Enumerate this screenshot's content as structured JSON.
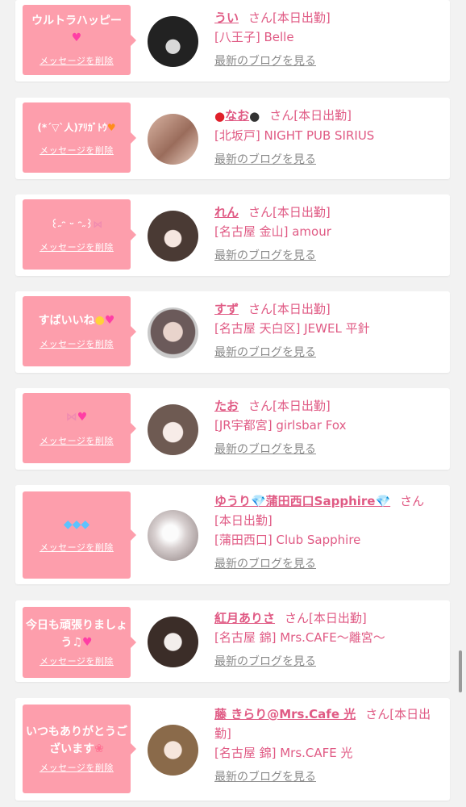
{
  "delete_label": "メッセージを削除",
  "blog_label": "最新のブログを見る",
  "san_label": "さん",
  "colors": {
    "accent_pink": "#fd9eac",
    "name_pink": "#e05a84",
    "link_gray": "#8a8a8a"
  },
  "items": [
    {
      "message": "ウルトラハッピー",
      "message_icon": "pink-heart-icon",
      "name": "うい",
      "status": "[本日出勤]",
      "shop": "[八王子] Belle"
    },
    {
      "message": "(*´▽`人)ｱﾘｶﾞﾄｳ",
      "message_icon": "orange-heart-icon",
      "name_prefix_icon": "apple-icon",
      "name": "なお",
      "name_suffix_icon": "gorilla-icon",
      "status": "[本日出勤]",
      "shop": "[北坂戸] NIGHT PUB SIRIUS"
    },
    {
      "message": "꒰˶ᵔ ᵕ ᵔ˶꒱",
      "message_icon": "ribbon-icon",
      "name": "れん",
      "status": "[本日出勤]",
      "shop": "[名古屋 金山] amour"
    },
    {
      "message": "すばいいね",
      "message_icon": "chick-heart-icon",
      "name": "すず",
      "status": "[本日出勤]",
      "shop": "[名古屋 天白区] JEWEL 平針"
    },
    {
      "message": "",
      "message_icon": "ribbon-heart-icon",
      "name": "たお",
      "status": "[本日出勤]",
      "shop": "[JR宇都宮] girlsbar Fox"
    },
    {
      "message": "",
      "message_icon": "gems-icon",
      "name": "ゆうり💎蒲田西口Sapphire💎",
      "status": "[本日出勤]",
      "shop": "[蒲田西口] Club Sapphire"
    },
    {
      "message": "今日も頑張りましょう",
      "message_icon": "music-heart-icon",
      "name": "紅月ありさ",
      "status": "[本日出勤]",
      "shop": "[名古屋 錦] Mrs.CAFE～離宮～"
    },
    {
      "message": "いつもありがとうございます",
      "message_icon": "tulip-icon",
      "name": "藤 きらり@Mrs.Cafe 光",
      "status": "[本日出勤]",
      "shop": "[名古屋 錦] Mrs.CAFE 光"
    }
  ]
}
